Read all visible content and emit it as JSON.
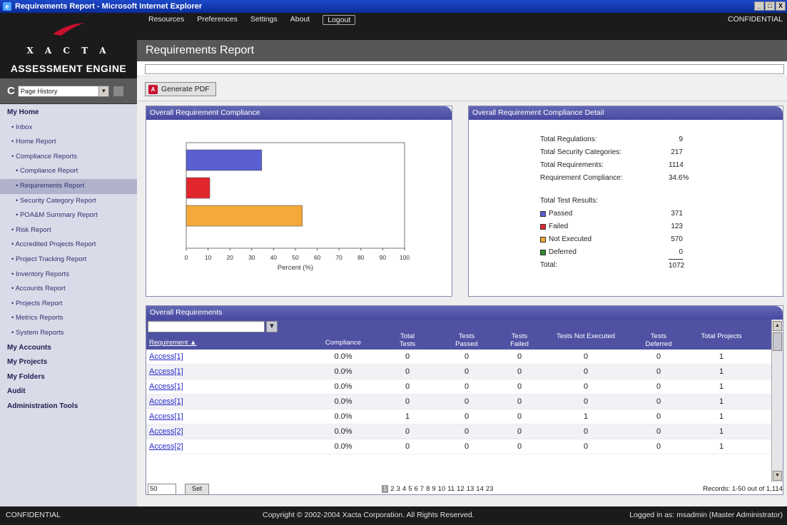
{
  "window": {
    "title": "Requirements Report - Microsoft Internet Explorer",
    "min": "_",
    "max": "□",
    "close": "X"
  },
  "logo": {
    "brand": "X A C T A",
    "product": "ASSESSMENT ENGINE"
  },
  "page_history": {
    "label": "C",
    "selected": "Page History"
  },
  "topnav": {
    "items": [
      "Resources",
      "Preferences",
      "Settings",
      "About"
    ],
    "logout": "Logout",
    "confidential": "CONFIDENTIAL"
  },
  "page_title": "Requirements Report",
  "toolbar": {
    "pdf_label": "Generate PDF"
  },
  "sidebar": {
    "items": [
      {
        "label": "My Home",
        "type": "head"
      },
      {
        "label": "• Inbox",
        "type": "item"
      },
      {
        "label": "• Home Report",
        "type": "item"
      },
      {
        "label": "• Compliance Reports",
        "type": "item"
      },
      {
        "label": "• Compliance Report",
        "type": "sub"
      },
      {
        "label": "• Requirements Report",
        "type": "sub sel"
      },
      {
        "label": "• Security Category Report",
        "type": "sub"
      },
      {
        "label": "• POA&M Summary Report",
        "type": "sub"
      },
      {
        "label": "• Risk Report",
        "type": "item"
      },
      {
        "label": "• Accredited Projects Report",
        "type": "item"
      },
      {
        "label": "• Project Tracking Report",
        "type": "item"
      },
      {
        "label": "• Inventory Reports",
        "type": "item"
      },
      {
        "label": "• Accounts Report",
        "type": "item"
      },
      {
        "label": "• Projects Report",
        "type": "item"
      },
      {
        "label": "• Metrics Reports",
        "type": "item"
      },
      {
        "label": "• System Reports",
        "type": "item"
      },
      {
        "label": "My Accounts",
        "type": "head"
      },
      {
        "label": "My Projects",
        "type": "head"
      },
      {
        "label": "My Folders",
        "type": "head"
      },
      {
        "label": "Audit",
        "type": "head"
      },
      {
        "label": "Administration Tools",
        "type": "head"
      }
    ]
  },
  "compliance_panel": {
    "title": "Overall Requirement Compliance"
  },
  "chart_data": {
    "type": "bar",
    "orientation": "horizontal",
    "categories": [
      "Passed",
      "Failed",
      "Not Executed",
      "Deferred"
    ],
    "values": [
      34.6,
      10.8,
      53.2,
      0
    ],
    "colors": [
      "#5b5fd1",
      "#e2262e",
      "#f5a93a",
      "#2e8b2e"
    ],
    "xlabel": "Percent (%)",
    "xlim": [
      0,
      100
    ],
    "xticks": [
      "0",
      "10",
      "20",
      "30",
      "40",
      "50",
      "60",
      "70",
      "80",
      "90",
      "100"
    ]
  },
  "detail_panel": {
    "title": "Overall Requirement Compliance Detail",
    "stats": [
      {
        "label": "Total Regulations:",
        "value": "9"
      },
      {
        "label": "Total Security Categories:",
        "value": "217"
      },
      {
        "label": "Total Requirements:",
        "value": "1114"
      },
      {
        "label": "Requirement Compliance:",
        "value": "34.6%"
      }
    ],
    "results_title": "Total Test Results:",
    "results": [
      {
        "label": "Passed",
        "value": "371",
        "color": "#5b5fd1"
      },
      {
        "label": "Failed",
        "value": "123",
        "color": "#e2262e"
      },
      {
        "label": "Not Executed",
        "value": "570",
        "color": "#f5a93a"
      },
      {
        "label": "Deferred",
        "value": "0",
        "color": "#2e8b2e"
      }
    ],
    "total_label": "Total:",
    "total_value": "1072"
  },
  "table": {
    "title": "Overall Requirements",
    "filter_icon": "▼",
    "headers": {
      "req": "Requirement ▲",
      "compliance": "Compliance",
      "total_tests": "Total Tests",
      "passed": "Tests Passed",
      "failed": "Tests Failed",
      "not_exec": "Tests Not Executed",
      "deferred": "Tests Deferred",
      "projects": "Total Projects"
    },
    "rows": [
      {
        "req": "Access[1]",
        "compliance": "0.0%",
        "total": "0",
        "passed": "0",
        "failed": "0",
        "not_exec": "0",
        "deferred": "0",
        "projects": "1"
      },
      {
        "req": "Access[1]",
        "compliance": "0.0%",
        "total": "0",
        "passed": "0",
        "failed": "0",
        "not_exec": "0",
        "deferred": "0",
        "projects": "1"
      },
      {
        "req": "Access[1]",
        "compliance": "0.0%",
        "total": "0",
        "passed": "0",
        "failed": "0",
        "not_exec": "0",
        "deferred": "0",
        "projects": "1"
      },
      {
        "req": "Access[1]",
        "compliance": "0.0%",
        "total": "0",
        "passed": "0",
        "failed": "0",
        "not_exec": "0",
        "deferred": "0",
        "projects": "1"
      },
      {
        "req": "Access[1]",
        "compliance": "0.0%",
        "total": "1",
        "passed": "0",
        "failed": "0",
        "not_exec": "1",
        "deferred": "0",
        "projects": "1"
      },
      {
        "req": "Access[2]",
        "compliance": "0.0%",
        "total": "0",
        "passed": "0",
        "failed": "0",
        "not_exec": "0",
        "deferred": "0",
        "projects": "1"
      },
      {
        "req": "Access[2]",
        "compliance": "0.0%",
        "total": "0",
        "passed": "0",
        "failed": "0",
        "not_exec": "0",
        "deferred": "0",
        "projects": "1"
      }
    ],
    "per_page": "50",
    "set_label": "Set",
    "pages": [
      "1",
      "2",
      "3",
      "4",
      "5",
      "6",
      "7",
      "8",
      "9",
      "10",
      "11",
      "12",
      "13",
      "14",
      "23"
    ],
    "current_page": "1",
    "records": "Records: 1-50 out of 1,114"
  },
  "footer": {
    "left": "CONFIDENTIAL",
    "center": "Copyright © 2002-2004 Xacta Corporation. All Rights Reserved.",
    "right": "Logged in as: msadmin (Master Administrator)"
  }
}
